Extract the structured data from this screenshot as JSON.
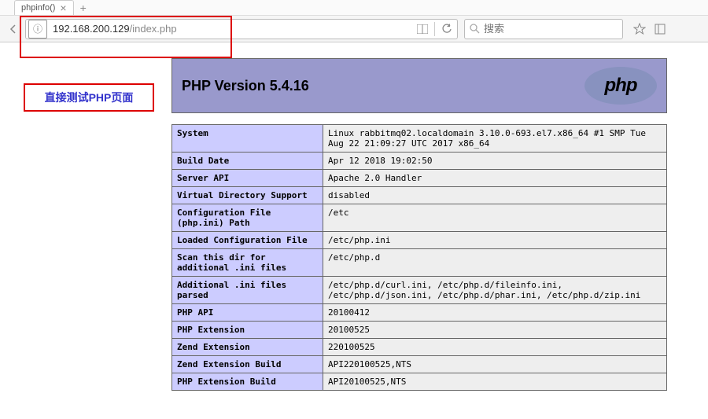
{
  "tab": {
    "title": "phpinfo()"
  },
  "url": {
    "host": "192.168.200.129",
    "path": "/index.php"
  },
  "search": {
    "placeholder": "搜索"
  },
  "annotation": {
    "text": "直接测试PHP页面"
  },
  "phpinfo": {
    "title": "PHP Version 5.4.16",
    "logo_text": "php",
    "rows": [
      {
        "label": "System",
        "value": "Linux rabbitmq02.localdomain 3.10.0-693.el7.x86_64 #1 SMP Tue Aug 22 21:09:27 UTC 2017 x86_64"
      },
      {
        "label": "Build Date",
        "value": "Apr 12 2018 19:02:50"
      },
      {
        "label": "Server API",
        "value": "Apache 2.0 Handler"
      },
      {
        "label": "Virtual Directory Support",
        "value": "disabled"
      },
      {
        "label": "Configuration File (php.ini) Path",
        "value": "/etc"
      },
      {
        "label": "Loaded Configuration File",
        "value": "/etc/php.ini"
      },
      {
        "label": "Scan this dir for additional .ini files",
        "value": "/etc/php.d"
      },
      {
        "label": "Additional .ini files parsed",
        "value": "/etc/php.d/curl.ini, /etc/php.d/fileinfo.ini, /etc/php.d/json.ini, /etc/php.d/phar.ini, /etc/php.d/zip.ini"
      },
      {
        "label": "PHP API",
        "value": "20100412"
      },
      {
        "label": "PHP Extension",
        "value": "20100525"
      },
      {
        "label": "Zend Extension",
        "value": "220100525"
      },
      {
        "label": "Zend Extension Build",
        "value": "API220100525,NTS"
      },
      {
        "label": "PHP Extension Build",
        "value": "API20100525,NTS"
      }
    ]
  }
}
